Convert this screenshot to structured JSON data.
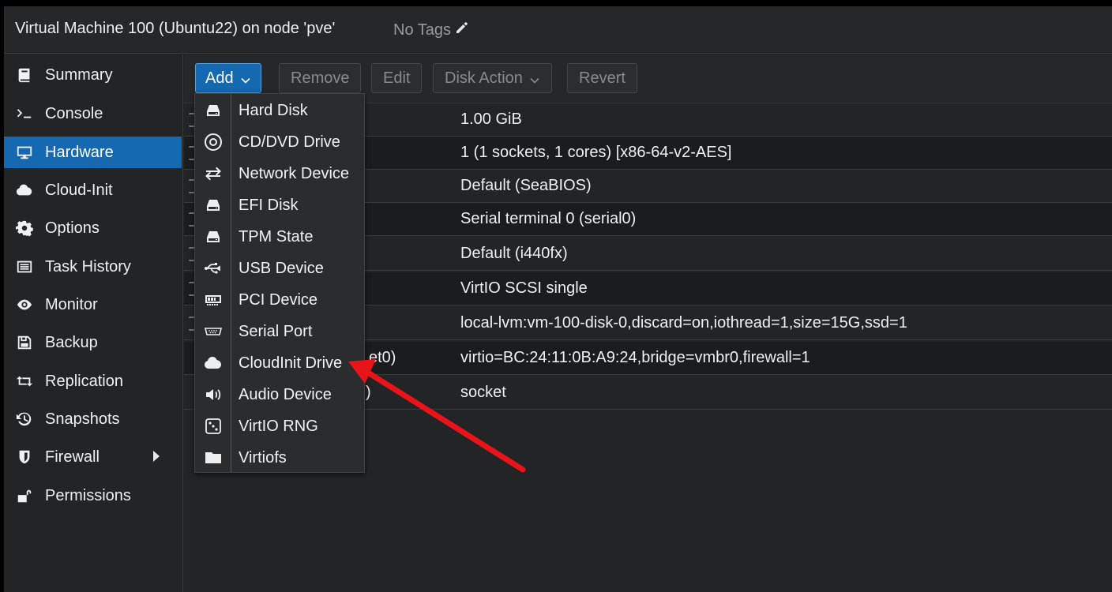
{
  "header": {
    "title": "Virtual Machine 100 (Ubuntu22) on node 'pve'",
    "tags_label": "No Tags"
  },
  "sidebar": {
    "items": [
      {
        "label": "Summary",
        "icon": "book-icon"
      },
      {
        "label": "Console",
        "icon": "terminal-icon"
      },
      {
        "label": "Hardware",
        "icon": "monitor-icon",
        "active": true
      },
      {
        "label": "Cloud-Init",
        "icon": "cloud-icon"
      },
      {
        "label": "Options",
        "icon": "gear-icon"
      },
      {
        "label": "Task History",
        "icon": "list-icon"
      },
      {
        "label": "Monitor",
        "icon": "eye-icon"
      },
      {
        "label": "Backup",
        "icon": "floppy-icon"
      },
      {
        "label": "Replication",
        "icon": "retweet-icon"
      },
      {
        "label": "Snapshots",
        "icon": "history-icon"
      },
      {
        "label": "Firewall",
        "icon": "shield-icon"
      },
      {
        "label": "Permissions",
        "icon": "unlock-icon"
      }
    ]
  },
  "toolbar": {
    "add": "Add",
    "remove": "Remove",
    "edit": "Edit",
    "disk_action": "Disk Action",
    "revert": "Revert"
  },
  "hardware_rows": [
    {
      "value": "1.00 GiB"
    },
    {
      "value": "1 (1 sockets, 1 cores) [x86-64-v2-AES]"
    },
    {
      "value": "Default (SeaBIOS)"
    },
    {
      "value": "Serial terminal 0 (serial0)"
    },
    {
      "value": "Default (i440fx)"
    },
    {
      "value": "VirtIO SCSI single"
    },
    {
      "value": "local-lvm:vm-100-disk-0,discard=on,iothread=1,size=15G,ssd=1"
    },
    {
      "label_fragment": "et0)",
      "value": "virtio=BC:24:11:0B:A9:24,bridge=vmbr0,firewall=1"
    },
    {
      "label_fragment": ")",
      "value": "socket"
    }
  ],
  "add_menu": {
    "items": [
      {
        "label": "Hard Disk",
        "icon": "hdd-icon"
      },
      {
        "label": "CD/DVD Drive",
        "icon": "disc-icon"
      },
      {
        "label": "Network Device",
        "icon": "exchange-icon"
      },
      {
        "label": "EFI Disk",
        "icon": "hdd-icon"
      },
      {
        "label": "TPM State",
        "icon": "hdd-icon"
      },
      {
        "label": "USB Device",
        "icon": "usb-icon"
      },
      {
        "label": "PCI Device",
        "icon": "pci-card-icon"
      },
      {
        "label": "Serial Port",
        "icon": "serial-port-icon"
      },
      {
        "label": "CloudInit Drive",
        "icon": "cloud-icon"
      },
      {
        "label": "Audio Device",
        "icon": "speaker-icon"
      },
      {
        "label": "VirtIO RNG",
        "icon": "dice-icon"
      },
      {
        "label": "Virtiofs",
        "icon": "folder-icon"
      }
    ]
  },
  "annotation": {
    "arrow_color": "#e8141a"
  }
}
